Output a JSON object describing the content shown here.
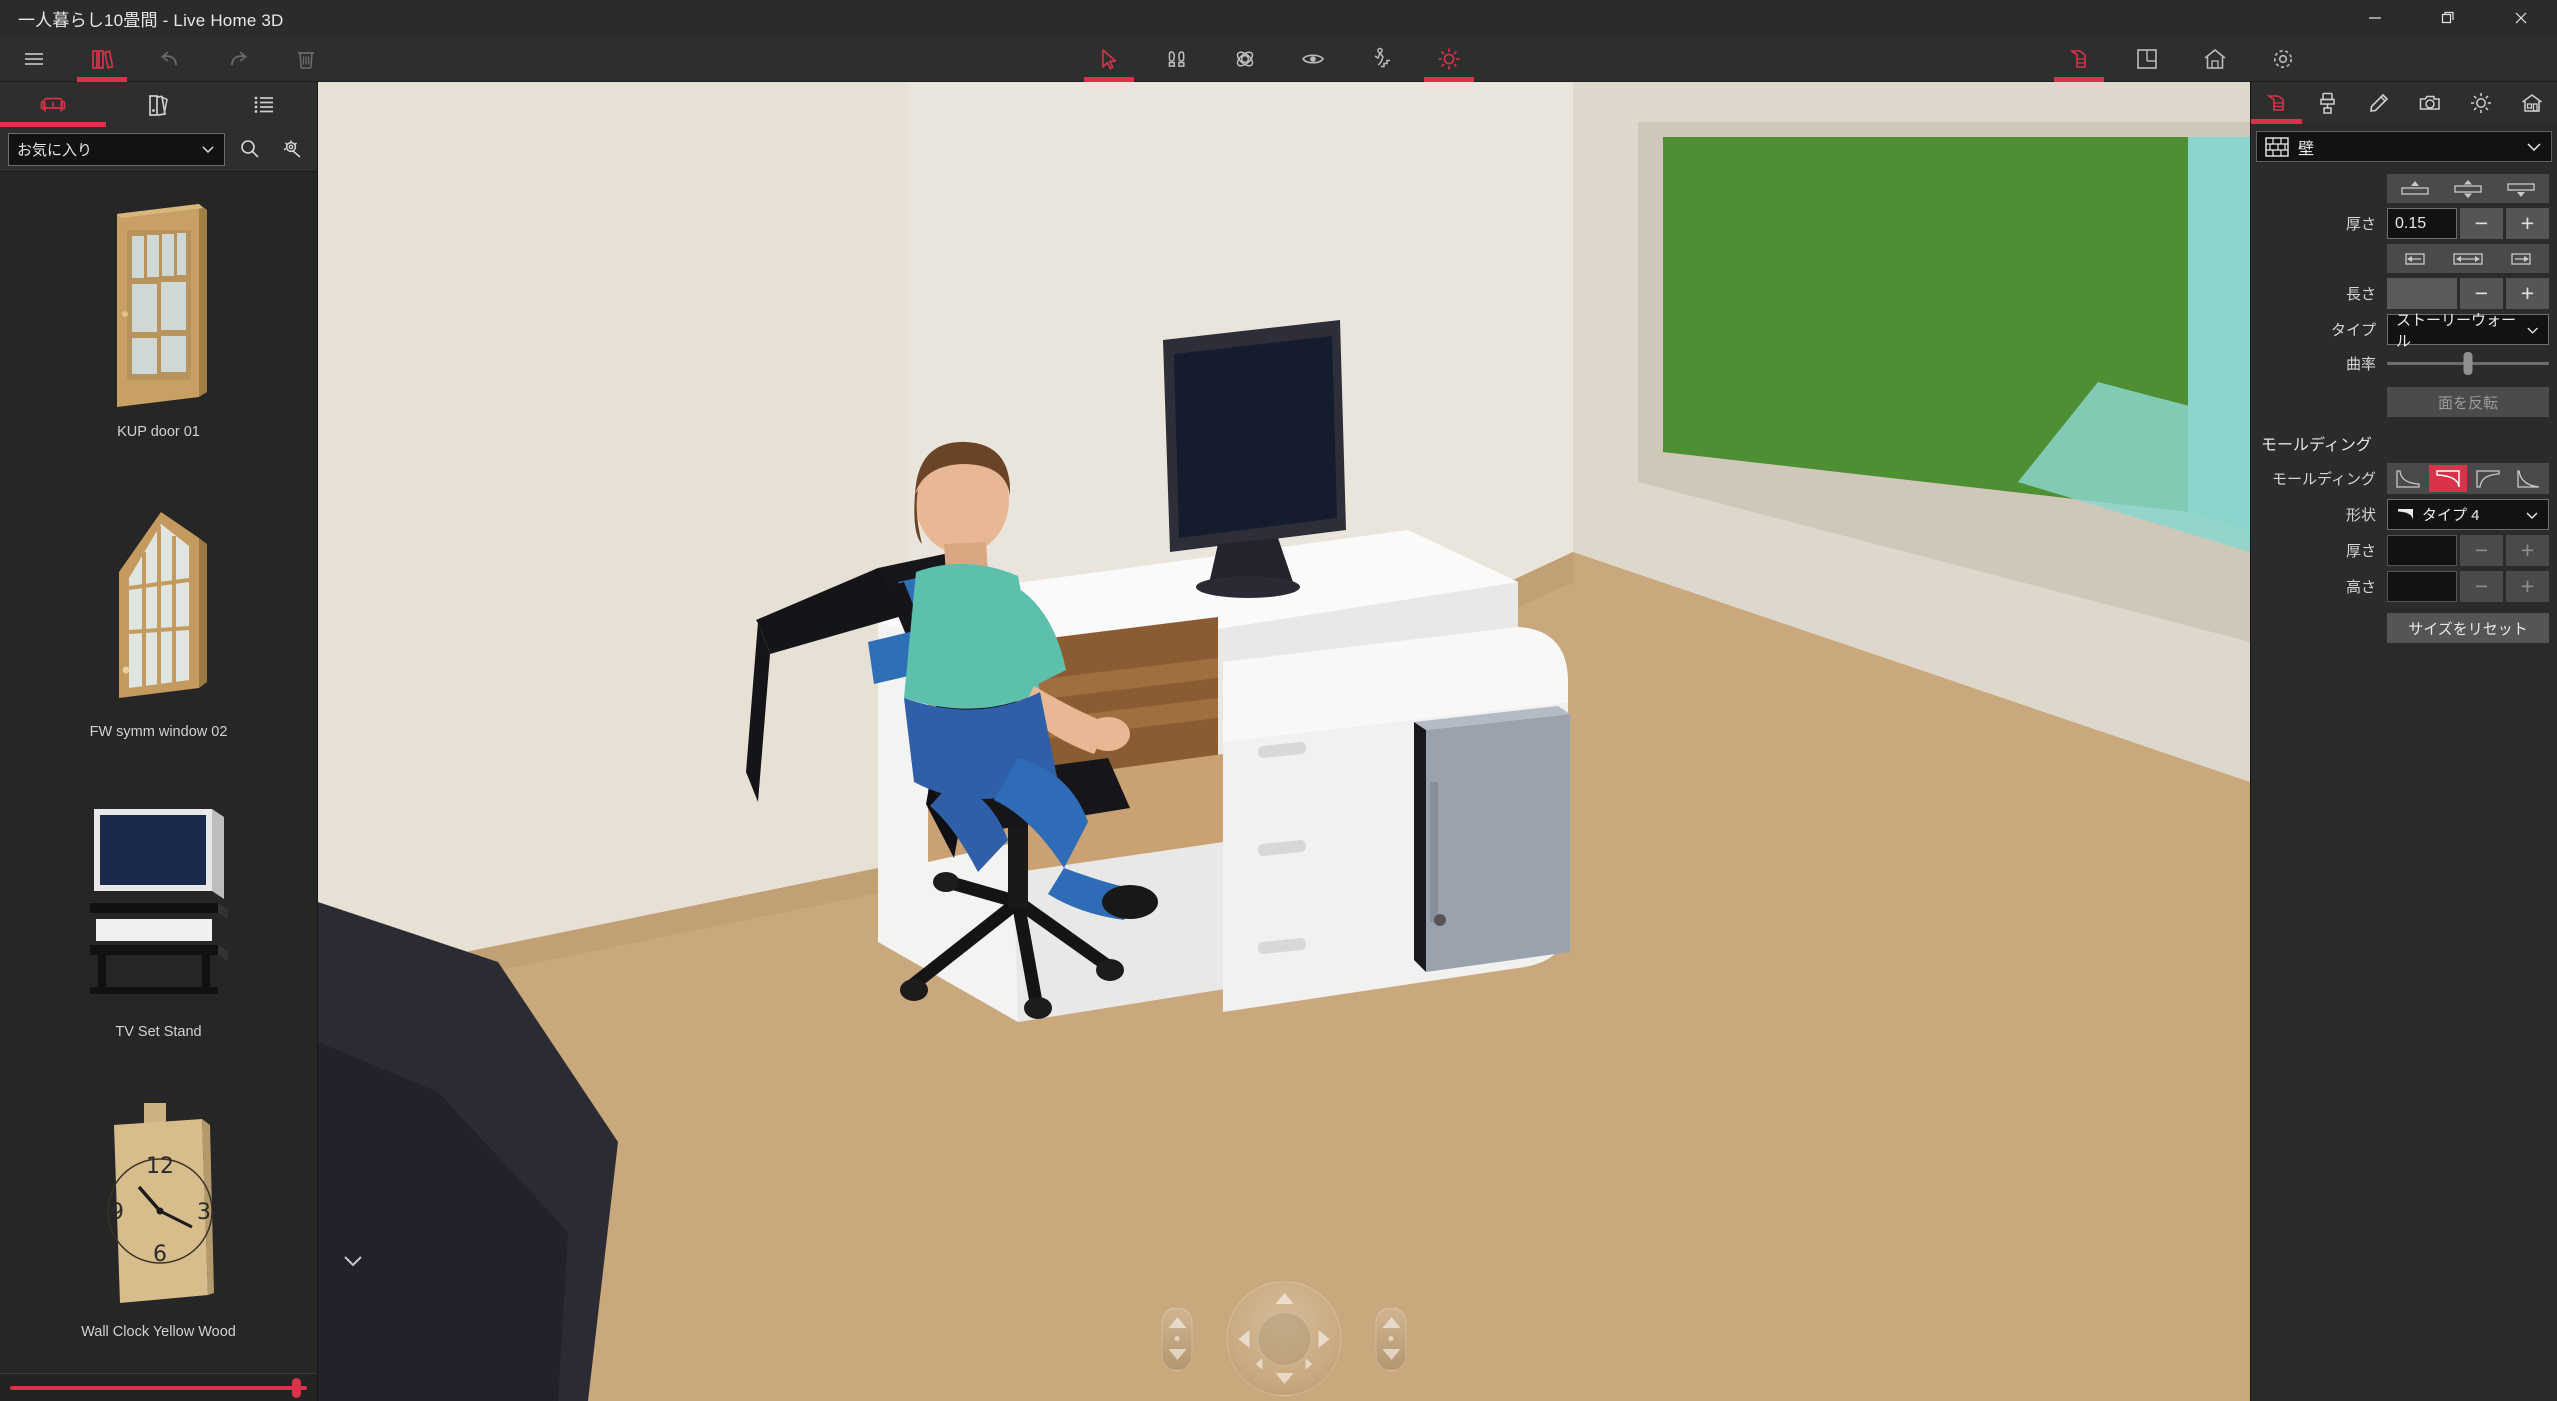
{
  "window": {
    "title": "一人暮らし10畳間 - Live Home 3D",
    "minimize_label": "最小化",
    "restore_label": "元に戻す",
    "close_label": "閉じる"
  },
  "toolbar": {
    "left": [
      {
        "name": "menu-icon",
        "label": "メニュー",
        "active": false
      },
      {
        "name": "library-icon",
        "label": "ライブラリ",
        "active": true
      },
      {
        "name": "undo-icon",
        "label": "元に戻す",
        "active": false
      },
      {
        "name": "redo-icon",
        "label": "やり直し",
        "active": false
      },
      {
        "name": "trash-icon",
        "label": "削除",
        "active": false
      }
    ],
    "center": [
      {
        "name": "cursor-icon",
        "label": "選択",
        "active": true
      },
      {
        "name": "footprints-icon",
        "label": "移動",
        "active": false
      },
      {
        "name": "orbit-icon",
        "label": "回転",
        "active": false
      },
      {
        "name": "eye-icon",
        "label": "表示",
        "active": false
      },
      {
        "name": "walkthrough-icon",
        "label": "ウォークスルー",
        "active": false
      },
      {
        "name": "sun-icon",
        "label": "光源",
        "active": true
      }
    ],
    "right": [
      {
        "name": "wall-icon",
        "label": "壁",
        "active": true
      },
      {
        "name": "floorplan-icon",
        "label": "間取り",
        "active": false
      },
      {
        "name": "home-icon",
        "label": "ホーム",
        "active": false
      },
      {
        "name": "settings-icon",
        "label": "設定",
        "active": false
      }
    ]
  },
  "sidebar": {
    "tabs": [
      {
        "name": "tab-furniture",
        "label": "家具",
        "active": true
      },
      {
        "name": "tab-materials",
        "label": "マテリアル",
        "active": false
      },
      {
        "name": "tab-list",
        "label": "リスト",
        "active": false
      }
    ],
    "category": {
      "selected": "お気に入り",
      "chevron": "▼"
    },
    "search_label": "検索",
    "settings_label": "設定",
    "items": [
      {
        "label": "KUP door 01",
        "thumb": "door"
      },
      {
        "label": "FW symm window 02",
        "thumb": "window"
      },
      {
        "label": "TV Set Stand",
        "thumb": "tvstand"
      },
      {
        "label": "Wall Clock Yellow Wood",
        "thumb": "clock"
      }
    ],
    "zoom_slider": {
      "label": "サムネイルサイズ",
      "value": 100
    }
  },
  "viewport": {
    "collapse_label": "パネルを閉じる",
    "nav": {
      "left_pill_label": "高さ調整",
      "right_pill_label": "ズーム",
      "disc_label": "移動コントロール"
    }
  },
  "inspector": {
    "tabs": [
      {
        "name": "tab-object",
        "label": "オブジェクト",
        "active": true
      },
      {
        "name": "tab-material",
        "label": "マテリアル",
        "active": false
      },
      {
        "name": "tab-edit",
        "label": "編集",
        "active": false
      },
      {
        "name": "tab-camera",
        "label": "カメラ",
        "active": false
      },
      {
        "name": "tab-light",
        "label": "照明",
        "active": false
      },
      {
        "name": "tab-building",
        "label": "建物",
        "active": false
      }
    ],
    "header": {
      "icon": "wall-brick-icon",
      "title": "壁",
      "chevron": "⌄"
    },
    "thickness": {
      "label": "厚さ",
      "value": "0.15",
      "presets": [
        "align-top",
        "align-center",
        "align-bottom"
      ],
      "minus": "−",
      "plus": "+"
    },
    "length": {
      "label": "長さ",
      "value": "",
      "presets": [
        "extend-left",
        "extend-both",
        "extend-right"
      ],
      "minus": "−",
      "plus": "+"
    },
    "type": {
      "label": "タイプ",
      "value": "ストーリーウォール",
      "chevron": "⌄"
    },
    "curvature": {
      "label": "曲率",
      "value": 50
    },
    "flip_face": {
      "label": "面を反転",
      "enabled": false
    },
    "molding_section": {
      "title": "モールディング",
      "molding": {
        "label": "モールディング",
        "options": [
          "type-1",
          "type-2",
          "type-3",
          "type-4"
        ],
        "selected_index": 1
      },
      "shape": {
        "label": "形状",
        "value": "タイプ 4",
        "chevron": "⌄"
      },
      "thickness": {
        "label": "厚さ",
        "value": "",
        "minus": "−",
        "plus": "+"
      },
      "height": {
        "label": "高さ",
        "value": "",
        "minus": "−",
        "plus": "+"
      },
      "reset_button": "サイズをリセット"
    }
  },
  "colors": {
    "accent": "#d9324a",
    "panel_bg": "#2b2b2b",
    "field_bg": "#121212",
    "viewport_wall": "#e9e5dc",
    "viewport_floor": "#c8a87c",
    "grass": "#4f8f33"
  }
}
